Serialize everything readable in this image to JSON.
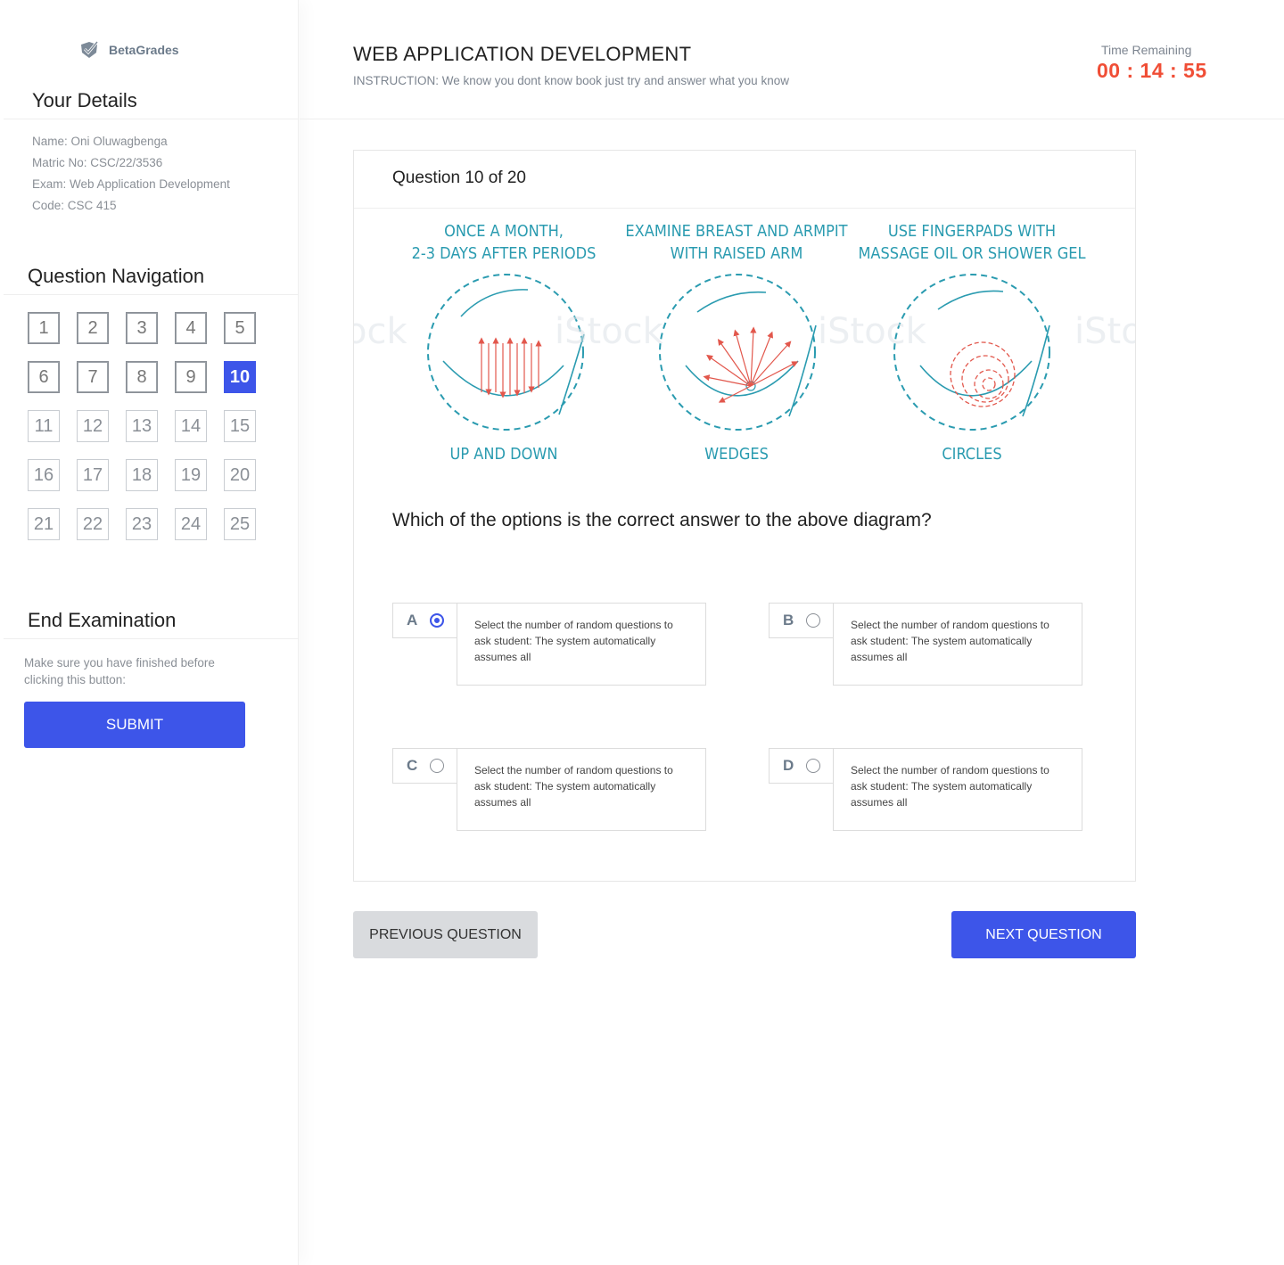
{
  "brand": {
    "name": "BetaGrades",
    "logo_icon": "check-shield-icon"
  },
  "details": {
    "title": "Your Details",
    "name": "Name: Oni Oluwagbenga",
    "matric": "Matric No: CSC/22/3536",
    "exam": "Exam: Web Application Development",
    "code": "Code: CSC 415"
  },
  "navigation": {
    "title": "Question Navigation",
    "current": 10,
    "items": [
      "1",
      "2",
      "3",
      "4",
      "5",
      "6",
      "7",
      "8",
      "9",
      "10",
      "11",
      "12",
      "13",
      "14",
      "15",
      "16",
      "17",
      "18",
      "19",
      "20",
      "21",
      "22",
      "23",
      "24",
      "25"
    ]
  },
  "end_exam": {
    "title": "End Examination",
    "note": "Make sure you have finished before clicking this button:",
    "submit_label": "SUBMIT"
  },
  "header": {
    "title": "WEB APPLICATION DEVELOPMENT",
    "instruction": "INSTRUCTION:  We know you dont know book just try and answer what you know",
    "timer_label": "Time Remaining",
    "timer": "00 : 14 : 55"
  },
  "question": {
    "counter": "Question 10 of 20",
    "text": "Which of the options is the correct answer to the above diagram?",
    "diagram": {
      "panels": [
        {
          "heading_1": "ONCE A MONTH,",
          "heading_2": "2-3 DAYS AFTER PERIODS",
          "caption": "UP AND DOWN"
        },
        {
          "heading_1": "EXAMINE BREAST AND ARMPIT",
          "heading_2": "WITH RAISED ARM",
          "caption": "WEDGES"
        },
        {
          "heading_1": "USE FINGERPADS WITH",
          "heading_2": "MASSAGE OIL OR SHOWER GEL",
          "caption": "CIRCLES"
        }
      ],
      "colors": {
        "teal": "#2a9bb0",
        "arrow": "#e2574c"
      }
    },
    "options": [
      {
        "letter": "A",
        "selected": true,
        "text": "Select the number of random questions to ask student: The system automatically assumes all"
      },
      {
        "letter": "B",
        "selected": false,
        "text": "Select the number of random questions to ask student: The system automatically assumes all"
      },
      {
        "letter": "C",
        "selected": false,
        "text": "Select the number of random questions to ask student: The system automatically assumes all"
      },
      {
        "letter": "D",
        "selected": false,
        "text": "Select the number of random questions to ask student: The system automatically assumes all"
      }
    ]
  },
  "buttons": {
    "previous": "PREVIOUS QUESTION",
    "next": "NEXT QUESTION"
  },
  "colors": {
    "accent": "#3d55e9",
    "timer": "#f04e36"
  }
}
